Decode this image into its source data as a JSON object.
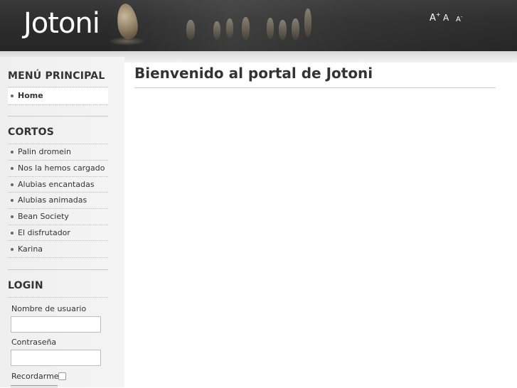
{
  "header": {
    "logo_text": "Jotoni",
    "font_controls": {
      "increase": "A",
      "increase_sup": "+",
      "reset": "A",
      "decrease": "A",
      "decrease_sup": "-"
    }
  },
  "sidebar": {
    "main_menu": {
      "title": "MENÚ PRINCIPAL",
      "items": [
        {
          "label": "Home",
          "active": true
        }
      ]
    },
    "shorts": {
      "title": "CORTOS",
      "items": [
        {
          "label": "Palin dromein"
        },
        {
          "label": "Nos la hemos cargado"
        },
        {
          "label": "Alubias encantadas"
        },
        {
          "label": "Alubias animadas"
        },
        {
          "label": "Bean Society"
        },
        {
          "label": "El disfrutador"
        },
        {
          "label": "Karina"
        }
      ]
    },
    "login": {
      "title": "LOGIN",
      "username_label": "Nombre de usuario",
      "username_value": "",
      "password_label": "Contraseña",
      "password_value": "",
      "remember_label": "Recordarme",
      "remember_checked": false
    }
  },
  "main": {
    "title": "Bienvenido al portal de Jotoni"
  },
  "colors": {
    "header_bg": "#2e2e2e",
    "sidebar_bg": "#f2f2f2",
    "text": "#333333",
    "logo": "#ffffff"
  }
}
